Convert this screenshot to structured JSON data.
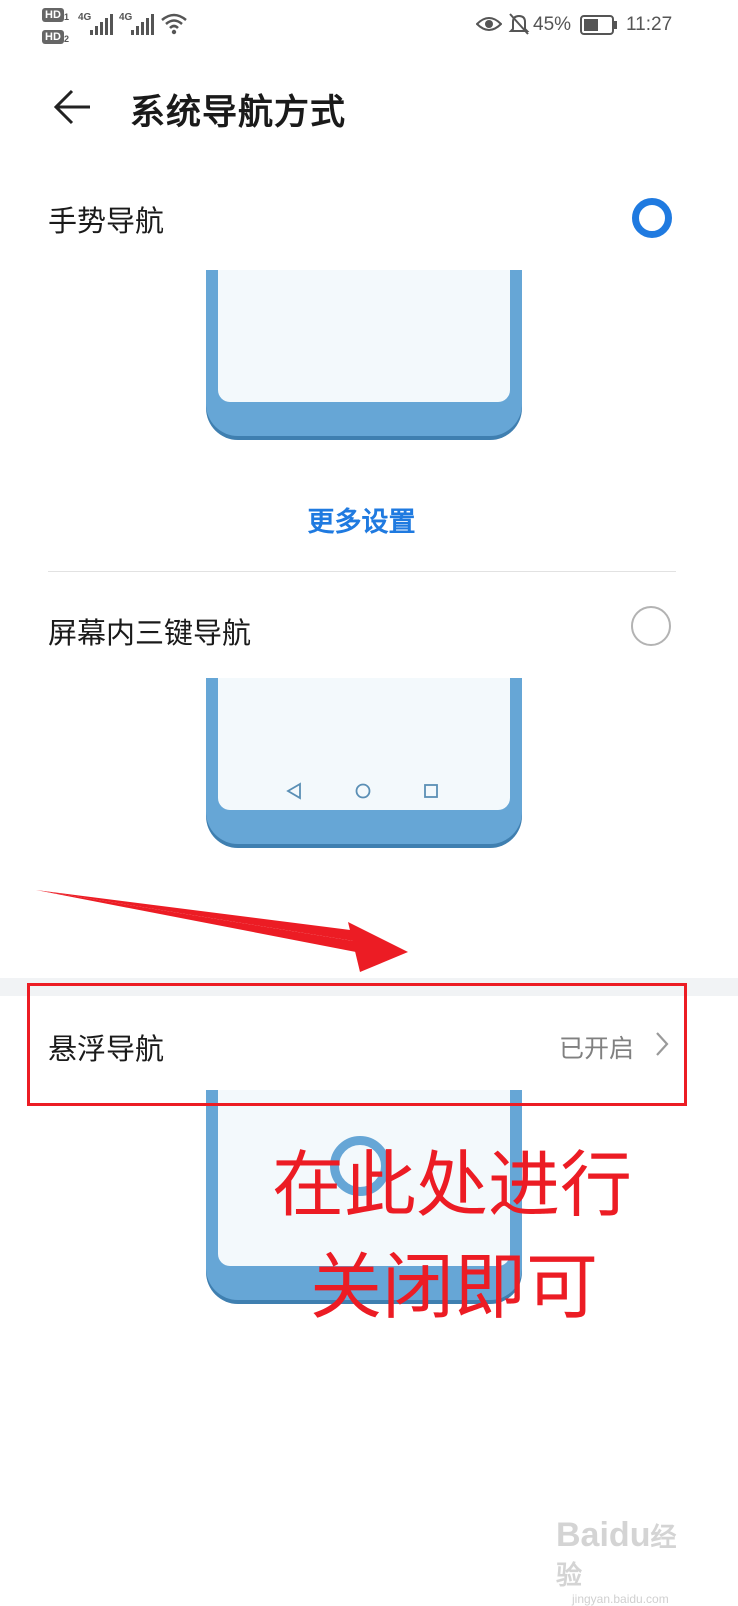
{
  "status_bar": {
    "sim1": "HD",
    "sim1_num": "1",
    "sim2": "HD",
    "sim2_num": "2",
    "net1": "4G",
    "net2": "4G",
    "battery": "45%",
    "time": "11:27",
    "icons": [
      "signal-icon",
      "signal-icon",
      "wifi-icon",
      "eye-icon",
      "bell-muted-icon",
      "battery-icon"
    ]
  },
  "header": {
    "back_icon": "arrow-left-icon",
    "title": "系统导航方式"
  },
  "options": [
    {
      "label": "手势导航",
      "selected": true
    },
    {
      "label": "屏幕内三键导航",
      "selected": false
    }
  ],
  "more_settings": "更多设置",
  "floating_nav": {
    "label": "悬浮导航",
    "value": "已开启",
    "chevron_icon": "chevron-right-icon"
  },
  "annotation": {
    "line1": "在此处进行",
    "line2": "关闭即可",
    "color": "#ec1c24"
  },
  "watermark": {
    "brand": "Bai",
    "brand2": "du",
    "brand3": "经验",
    "url": "jingyan.baidu.com"
  },
  "colors": {
    "accent": "#1f7ae0",
    "illustration": "#66a6d6"
  }
}
